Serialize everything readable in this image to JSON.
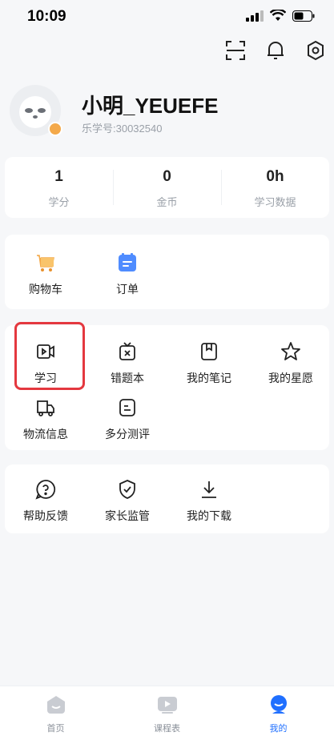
{
  "status_bar": {
    "time": "10:09"
  },
  "profile": {
    "username": "小明_YEUEFE",
    "user_id": "乐学号:30032540"
  },
  "stats": [
    {
      "value": "1",
      "label": "学分"
    },
    {
      "value": "0",
      "label": "金币"
    },
    {
      "value": "0h",
      "label": "学习数据"
    }
  ],
  "orders": [
    {
      "label": "购物车",
      "icon": "cart-icon"
    },
    {
      "label": "订单",
      "icon": "order-icon"
    }
  ],
  "services": [
    {
      "label": "学习",
      "icon": "study-video-icon"
    },
    {
      "label": "错题本",
      "icon": "wrong-questions-icon"
    },
    {
      "label": "我的笔记",
      "icon": "notes-icon"
    },
    {
      "label": "我的星愿",
      "icon": "star-icon"
    },
    {
      "label": "物流信息",
      "icon": "truck-icon"
    },
    {
      "label": "多分测评",
      "icon": "assessment-icon"
    }
  ],
  "support": [
    {
      "label": "帮助反馈",
      "icon": "help-icon"
    },
    {
      "label": "家长监管",
      "icon": "shield-icon"
    },
    {
      "label": "我的下载",
      "icon": "download-icon"
    }
  ],
  "tabbar": [
    {
      "label": "首页",
      "active": false
    },
    {
      "label": "课程表",
      "active": false
    },
    {
      "label": "我的",
      "active": true
    }
  ],
  "colors": {
    "accent": "#1f6fff",
    "highlight": "#e4383f",
    "cart": "#f4a94a",
    "order": "#4f8cff"
  }
}
